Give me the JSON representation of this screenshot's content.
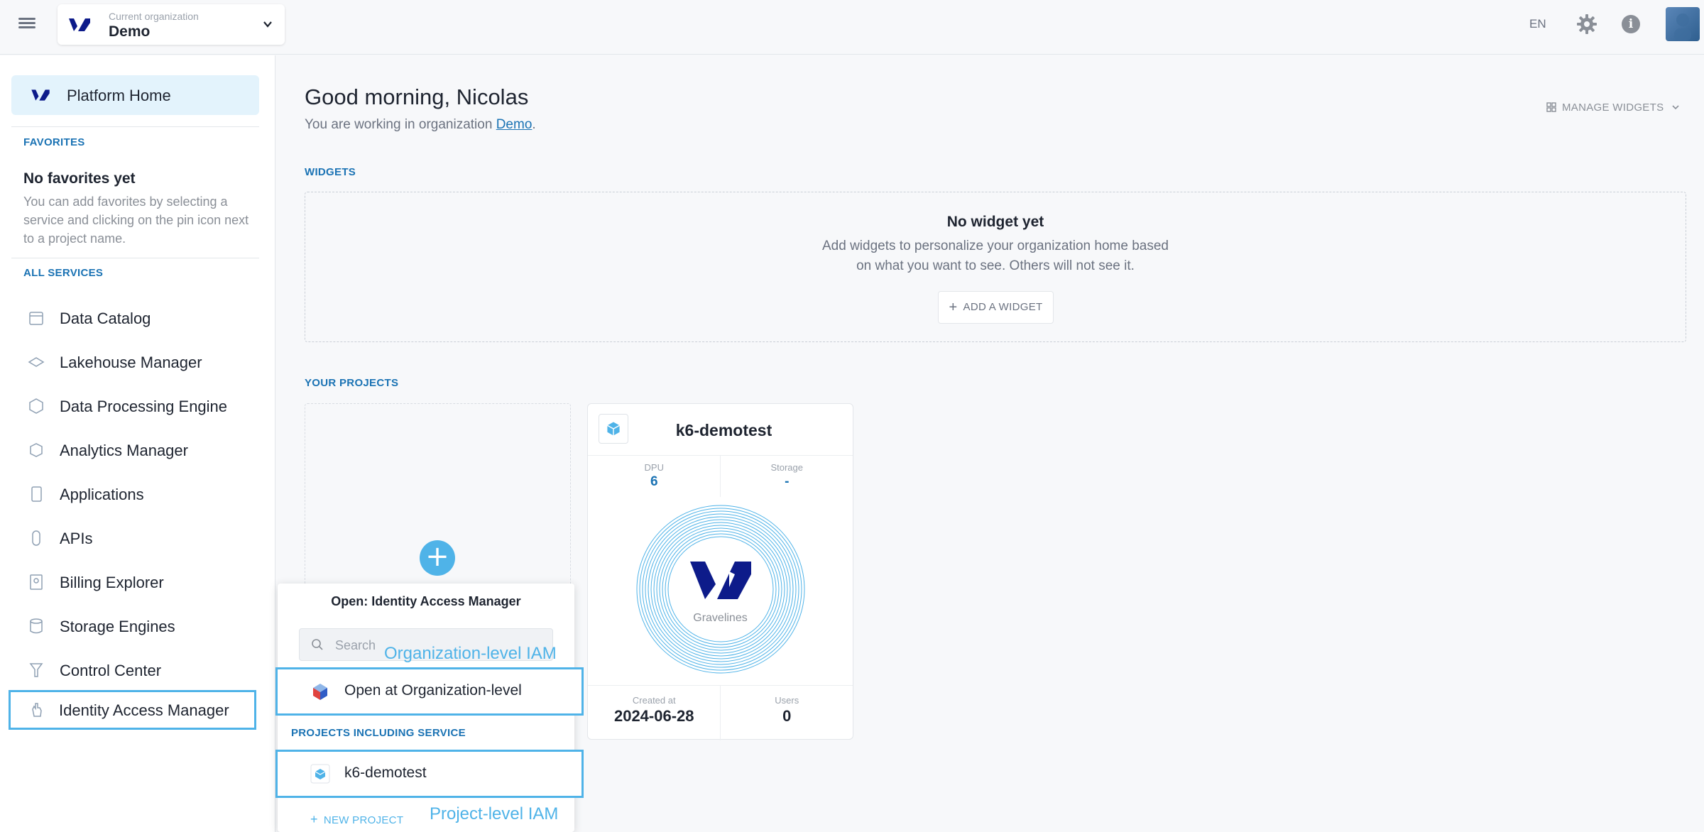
{
  "topbar": {
    "org_caption": "Current organization",
    "org_name": "Demo",
    "language": "EN"
  },
  "sidebar": {
    "home_label": "Platform Home",
    "favorites_title": "FAVORITES",
    "no_favorites_title": "No favorites yet",
    "no_favorites_desc": "You can add favorites by selecting a service and clicking on the pin icon next to a project name.",
    "all_services_title": "ALL SERVICES",
    "services": [
      {
        "label": "Data Catalog",
        "icon": "data-catalog-icon"
      },
      {
        "label": "Lakehouse Manager",
        "icon": "lakehouse-icon"
      },
      {
        "label": "Data Processing Engine",
        "icon": "processing-engine-icon"
      },
      {
        "label": "Analytics Manager",
        "icon": "analytics-icon"
      },
      {
        "label": "Applications",
        "icon": "applications-icon"
      },
      {
        "label": "APIs",
        "icon": "apis-icon"
      },
      {
        "label": "Billing Explorer",
        "icon": "billing-icon"
      },
      {
        "label": "Storage Engines",
        "icon": "storage-icon"
      },
      {
        "label": "Control Center",
        "icon": "control-center-icon"
      },
      {
        "label": "Identity Access Manager",
        "icon": "iam-hand-icon"
      }
    ]
  },
  "main": {
    "greeting": "Good morning, Nicolas",
    "subtext_prefix": "You are working in organization",
    "subtext_link": "Demo",
    "subtext_suffix": ".",
    "manage_widgets": "MANAGE WIDGETS",
    "widgets_title": "WIDGETS",
    "no_widget_title": "No widget yet",
    "no_widget_line1": "Add widgets to personalize your organization home based",
    "no_widget_line2": "on what you want to see. Others will not see it.",
    "add_widget": "ADD A WIDGET",
    "projects_title": "YOUR PROJECTS"
  },
  "project_card": {
    "name": "k6-demotest",
    "dpu_label": "DPU",
    "dpu_value": "6",
    "storage_label": "Storage",
    "storage_value": "-",
    "region": "Gravelines",
    "created_label": "Created at",
    "created_value": "2024-06-28",
    "users_label": "Users",
    "users_value": "0"
  },
  "popover": {
    "title": "Open: Identity Access Manager",
    "search_placeholder": "Search",
    "org_item": "Open at Organization-level",
    "projects_section": "PROJECTS INCLUDING SERVICE",
    "project_item": "k6-demotest",
    "new_project": "NEW PROJECT",
    "annotation_org": "Organization-level IAM",
    "annotation_project": "Project-level IAM"
  },
  "colors": {
    "accent": "#4fb3e8",
    "link": "#1b73b4",
    "brand_dark": "#0d1b8a"
  }
}
